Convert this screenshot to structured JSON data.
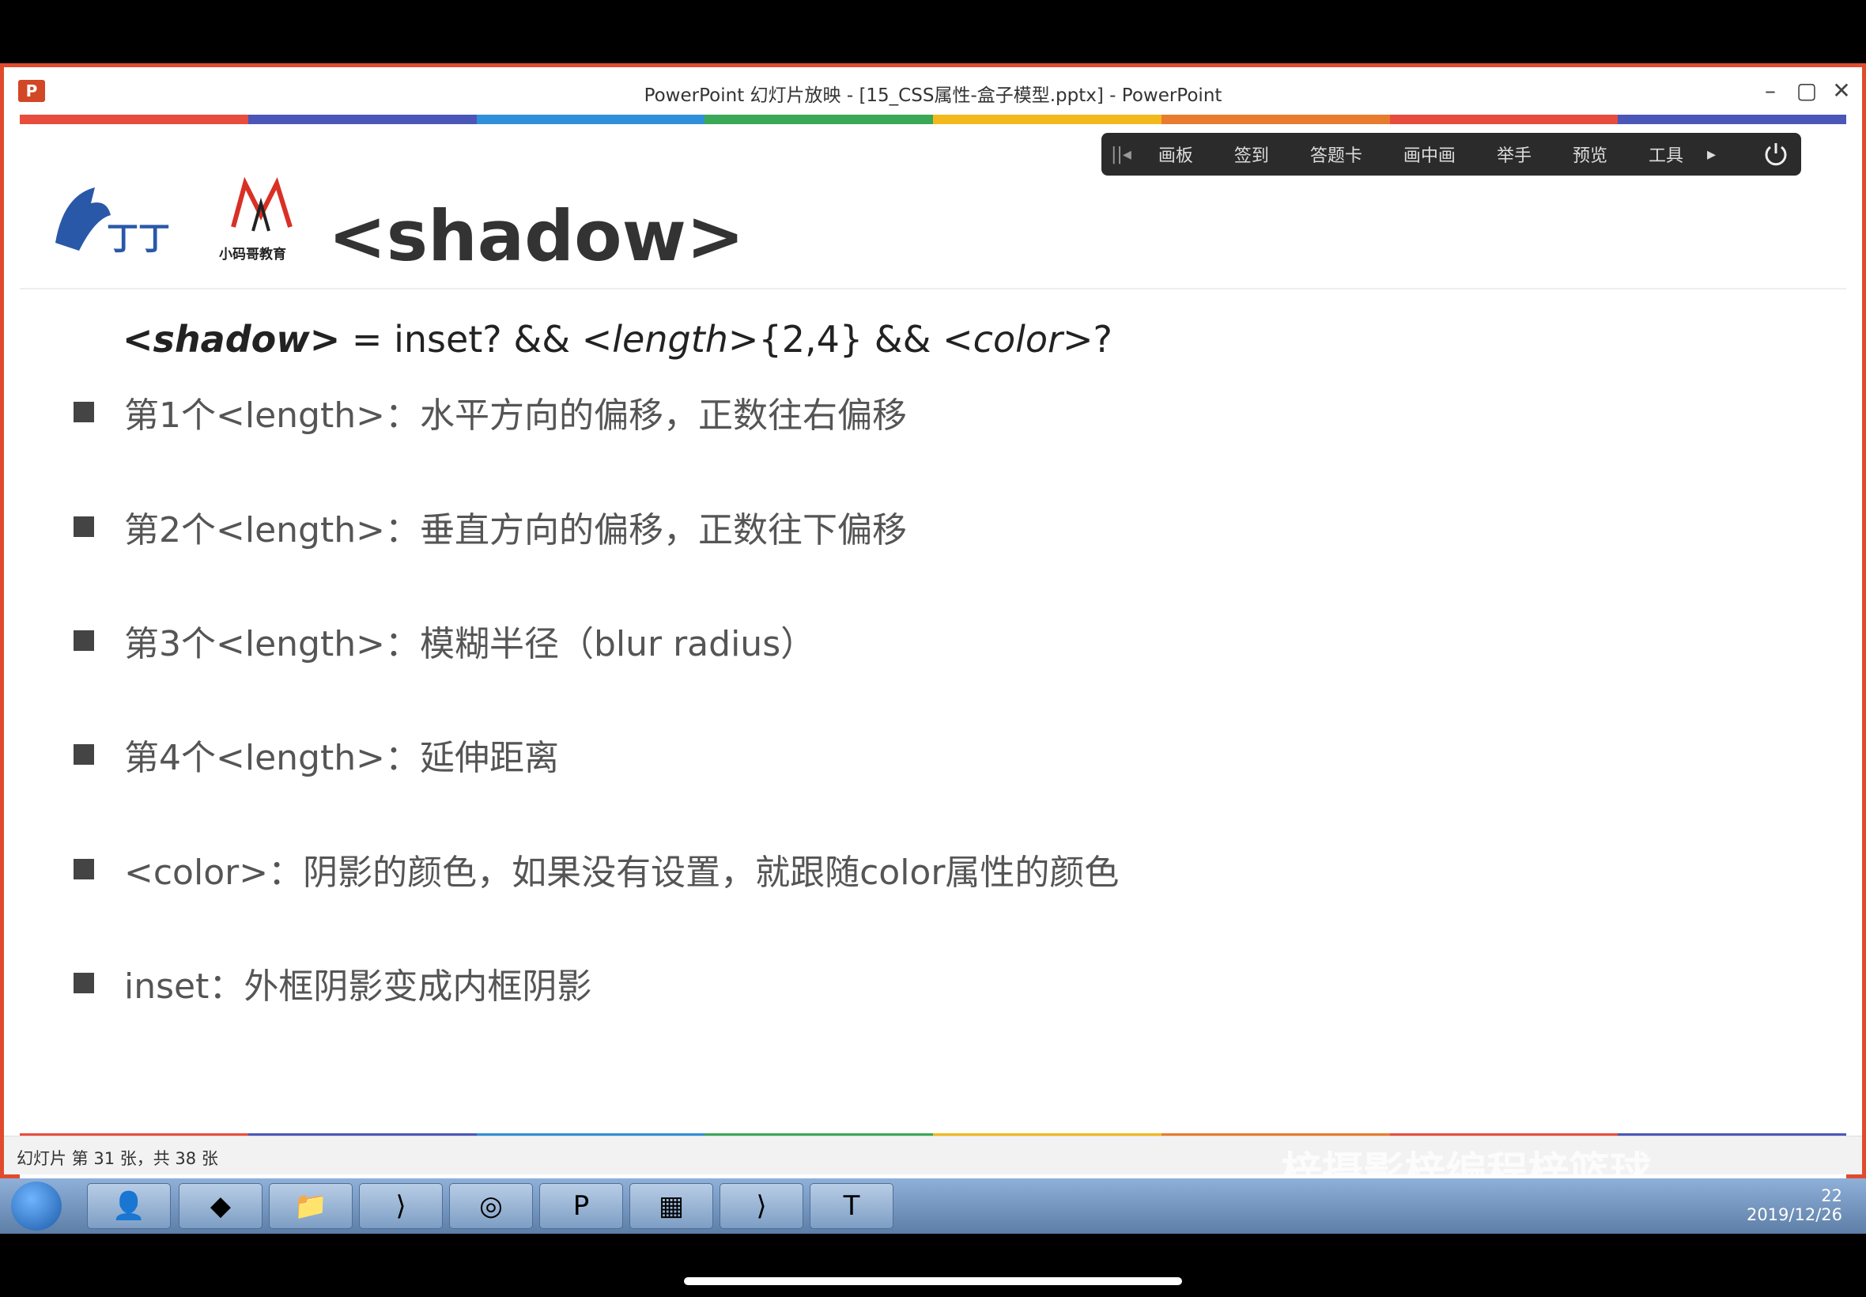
{
  "window": {
    "title": "PowerPoint 幻灯片放映 - [15_CSS属性-盒子模型.pptx] - PowerPoint",
    "app_icon": "P",
    "minimize": "–",
    "maximize": "▢",
    "close": "✕"
  },
  "toolbar": {
    "grip": "||◂",
    "items": [
      "画板",
      "签到",
      "答题卡",
      "画中画",
      "举手",
      "预览",
      "工具"
    ],
    "arrow": "▸"
  },
  "slide": {
    "title": "<shadow>",
    "logo_b_sub": "小码哥教育",
    "syntax": {
      "name": "<shadow>",
      "eq": " = inset? && ",
      "length": "<length>",
      "count": "{2,4} && ",
      "color": "<color>",
      "q": "?"
    },
    "bullets": [
      "第1个<length>：水平方向的偏移，正数往右偏移",
      "第2个<length>：垂直方向的偏移，正数往下偏移",
      "第3个<length>：模糊半径（blur radius）",
      "第4个<length>：延伸距离",
      "<color>：阴影的颜色，如果没有设置，就跟随color属性的颜色",
      "inset：外框阴影变成内框阴影"
    ]
  },
  "statusbar": {
    "text": "幻灯片 第 31 张，共 38 张"
  },
  "watermark": "梓摄影梓编程梓篮球",
  "taskbar": {
    "buttons": [
      "👤",
      "◆",
      "📁",
      "⟩",
      "◎",
      "P",
      "▦",
      "⟩",
      "T"
    ],
    "tray_badge": "22",
    "date": "2019/12/26"
  },
  "colors": {
    "stripe": [
      "#e84c3d",
      "#4a57b8",
      "#2f8fd8",
      "#3aa857",
      "#f2b81c",
      "#e87b2d",
      "#e84c3d",
      "#4a57b8"
    ]
  }
}
